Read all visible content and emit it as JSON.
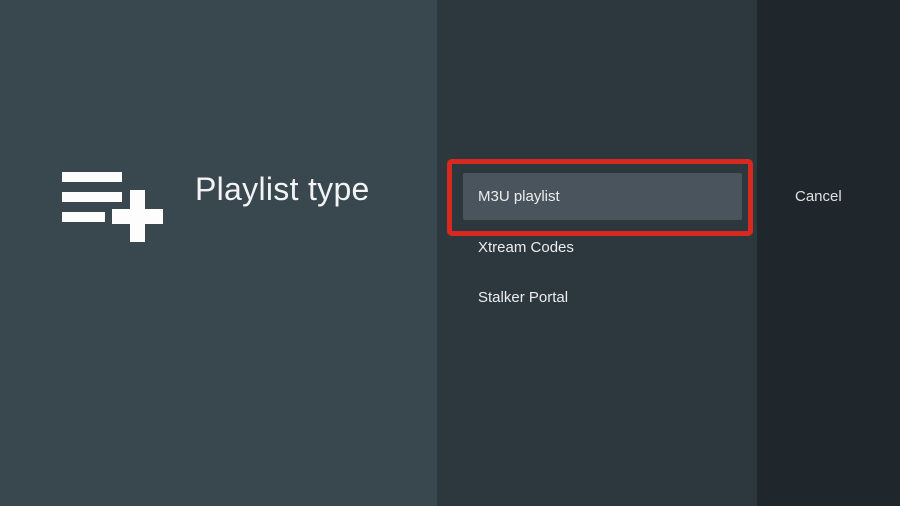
{
  "guidance": {
    "title": "Playlist type",
    "icon": "playlist-add-icon"
  },
  "options": [
    {
      "label": "M3U playlist",
      "state": "focused",
      "annotated": true
    },
    {
      "label": "Xtream Codes",
      "state": "default",
      "annotated": false
    },
    {
      "label": "Stalker Portal",
      "state": "default",
      "annotated": false
    }
  ],
  "actions": {
    "cancel_label": "Cancel"
  },
  "annotation": {
    "type": "highlight-rectangle",
    "target": "M3U playlist",
    "color": "#D7291D"
  },
  "colors": {
    "guidance_bg": "#39474F",
    "options_bg": "#2C383E",
    "cancel_bg": "#1F272C",
    "focused_option_bg": "#4A545C",
    "annotation_red": "#D7291D",
    "text_primary": "#F1F3F4",
    "text_option": "#ECEDEE"
  }
}
